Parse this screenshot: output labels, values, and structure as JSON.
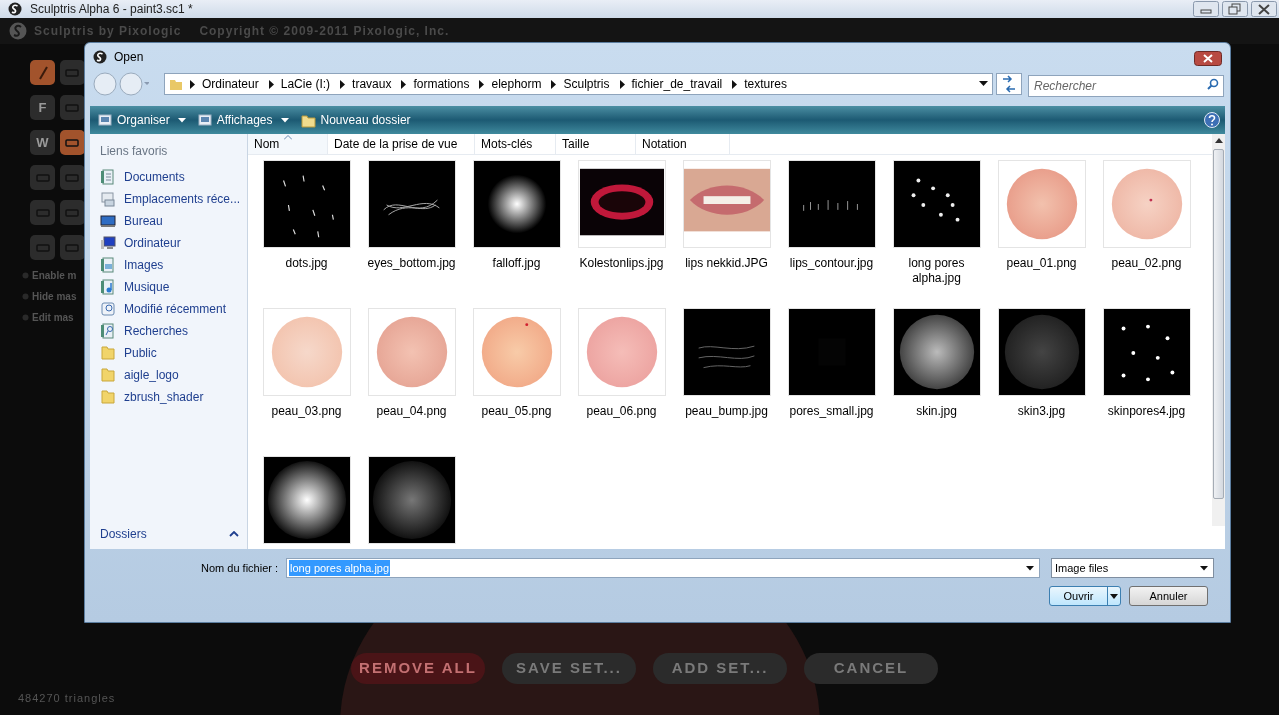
{
  "app": {
    "title": "Sculptris Alpha 6 - paint3.sc1 *",
    "brand": "Sculptris by Pixologic",
    "copyright": "Copyright © 2009-2011 Pixologic, Inc.",
    "tools": [
      {
        "kind": "brush",
        "selected": true
      },
      {
        "kind": "icon",
        "selected": false
      },
      {
        "kind": "letter",
        "label": "F",
        "selected": false
      },
      {
        "kind": "icon",
        "selected": false
      },
      {
        "kind": "letter",
        "label": "W",
        "selected": false
      },
      {
        "kind": "icon",
        "selected": true
      },
      {
        "kind": "icon",
        "selected": false
      },
      {
        "kind": "icon",
        "selected": false
      },
      {
        "kind": "icon",
        "selected": false
      },
      {
        "kind": "icon",
        "selected": false
      },
      {
        "kind": "icon",
        "selected": false
      },
      {
        "kind": "icon",
        "selected": false
      }
    ],
    "mask_options": [
      {
        "label": "Enable m",
        "checked": false
      },
      {
        "label": "Hide mas",
        "checked": false
      },
      {
        "label": "Edit mas",
        "checked": false
      }
    ],
    "buttons": [
      {
        "label": "REMOVE ALL",
        "kind": "danger"
      },
      {
        "label": "SAVE SET...",
        "kind": "normal"
      },
      {
        "label": "ADD SET...",
        "kind": "normal"
      },
      {
        "label": "CANCEL",
        "kind": "normal"
      }
    ],
    "status": "484270 triangles"
  },
  "dialog": {
    "title": "Open",
    "path": [
      "Ordinateur",
      "LaCie (I:)",
      "travaux",
      "formations",
      "elephorm",
      "Sculptris",
      "fichier_de_travail",
      "textures"
    ],
    "search": {
      "placeholder": "Rechercher"
    },
    "toolbar": [
      {
        "label": "Organiser",
        "kind": "menu"
      },
      {
        "label": "Affichages",
        "kind": "menu"
      },
      {
        "label": "Nouveau dossier",
        "kind": "folder"
      }
    ],
    "sidebar": {
      "title": "Liens favoris",
      "items": [
        {
          "label": "Documents",
          "kind": "documents"
        },
        {
          "label": "Emplacements réce...",
          "kind": "recent"
        },
        {
          "label": "Bureau",
          "kind": "desktop"
        },
        {
          "label": "Ordinateur",
          "kind": "computer"
        },
        {
          "label": "Images",
          "kind": "images"
        },
        {
          "label": "Musique",
          "kind": "music"
        },
        {
          "label": "Modifié récemment",
          "kind": "modified"
        },
        {
          "label": "Recherches",
          "kind": "searches"
        },
        {
          "label": "Public",
          "kind": "folder"
        },
        {
          "label": "aigle_logo",
          "kind": "folder"
        },
        {
          "label": "zbrush_shader",
          "kind": "folder"
        }
      ],
      "folders": "Dossiers"
    },
    "columns": [
      {
        "label": "Nom",
        "sorted": true
      },
      {
        "label": "Date de la prise de vue",
        "sorted": false
      },
      {
        "label": "Mots-clés",
        "sorted": false
      },
      {
        "label": "Taille",
        "sorted": false
      },
      {
        "label": "Notation",
        "sorted": false
      }
    ],
    "files": [
      {
        "name": "dots.jpg",
        "kind": "picture"
      },
      {
        "name": "eyes_bottom.jpg",
        "kind": "picture"
      },
      {
        "name": "falloff.jpg",
        "kind": "picture"
      },
      {
        "name": "Kolestonlips.jpg",
        "kind": "picture"
      },
      {
        "name": "lips nekkid.JPG",
        "kind": "picture"
      },
      {
        "name": "lips_contour.jpg",
        "kind": "picture"
      },
      {
        "name": "long pores alpha.jpg",
        "kind": "picture"
      },
      {
        "name": "peau_01.png",
        "kind": "picture"
      },
      {
        "name": "peau_02.png",
        "kind": "picture"
      },
      {
        "name": "peau_03.png",
        "kind": "picture"
      },
      {
        "name": "peau_04.png",
        "kind": "picture"
      },
      {
        "name": "peau_05.png",
        "kind": "picture"
      },
      {
        "name": "peau_06.png",
        "kind": "picture"
      },
      {
        "name": "peau_bump.jpg",
        "kind": "picture"
      },
      {
        "name": "pores_small.jpg",
        "kind": "picture"
      },
      {
        "name": "skin.jpg",
        "kind": "picture"
      },
      {
        "name": "skin3.jpg",
        "kind": "picture"
      },
      {
        "name": "skinpores4.jpg",
        "kind": "picture"
      },
      {
        "kind": "picture"
      },
      {
        "kind": "picture"
      }
    ],
    "filename_label": "Nom du fichier :",
    "filename": "long pores alpha.jpg",
    "filetype": "Image files",
    "open_button": "Ouvrir",
    "cancel_button": "Annuler"
  }
}
